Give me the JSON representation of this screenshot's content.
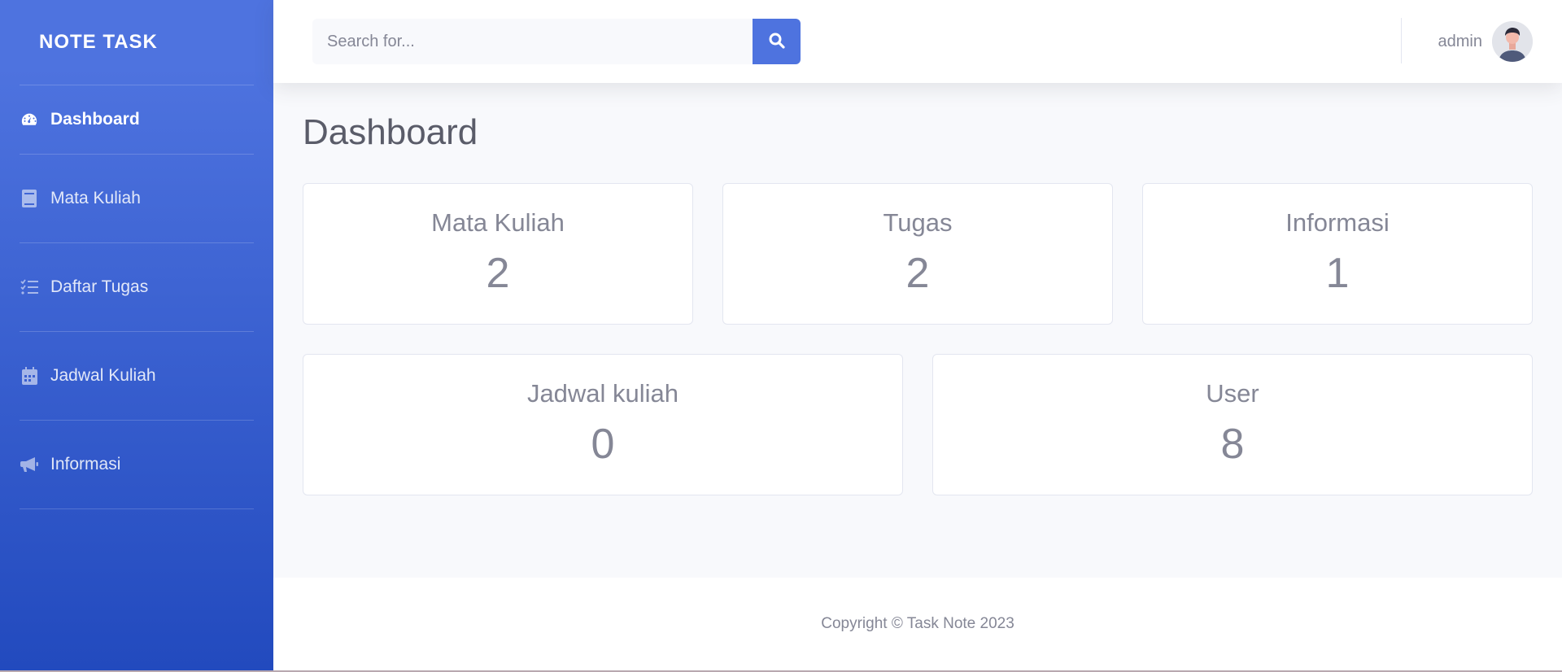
{
  "sidebar": {
    "brand": "NOTE TASK",
    "items": [
      {
        "label": "Dashboard",
        "icon": "tachometer-icon"
      },
      {
        "label": "Mata Kuliah",
        "icon": "book-icon"
      },
      {
        "label": "Daftar Tugas",
        "icon": "tasks-icon"
      },
      {
        "label": "Jadwal Kuliah",
        "icon": "calendar-icon"
      },
      {
        "label": "Informasi",
        "icon": "bullhorn-icon"
      }
    ]
  },
  "topbar": {
    "search": {
      "placeholder": "Search for...",
      "value": ""
    },
    "user": {
      "name": "admin"
    }
  },
  "main": {
    "title": "Dashboard",
    "cards": [
      {
        "label": "Mata Kuliah",
        "value": "2"
      },
      {
        "label": "Tugas",
        "value": "2"
      },
      {
        "label": "Informasi",
        "value": "1"
      },
      {
        "label": "Jadwal kuliah",
        "value": "0"
      },
      {
        "label": "User",
        "value": "8"
      }
    ]
  },
  "footer": {
    "text": "Copyright © Task Note 2023"
  },
  "colors": {
    "primary": "#4e73df",
    "primary_dark": "#224abe",
    "text_muted": "#858796"
  }
}
